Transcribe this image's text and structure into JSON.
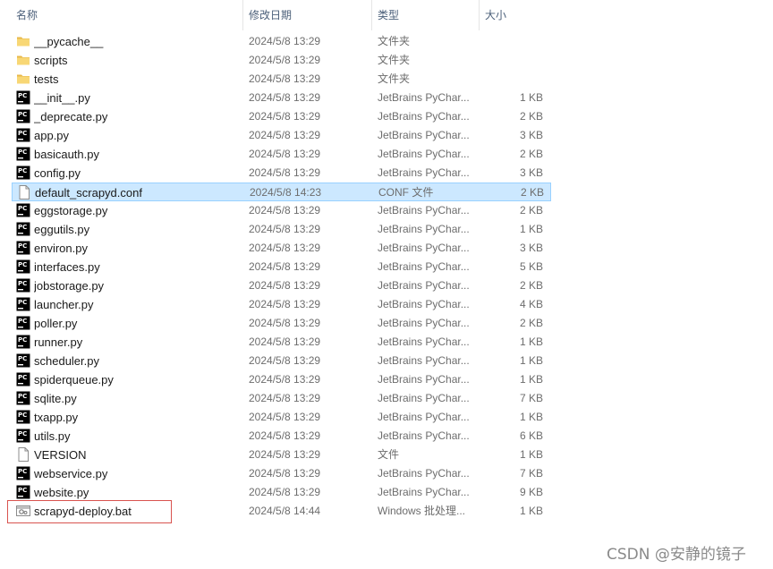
{
  "columns": {
    "name": "名称",
    "modified": "修改日期",
    "type": "类型",
    "size": "大小"
  },
  "files": [
    {
      "name": "__pycache__",
      "modified": "2024/5/8 13:29",
      "type": "文件夹",
      "size": "",
      "icon": "folder-icon"
    },
    {
      "name": "scripts",
      "modified": "2024/5/8 13:29",
      "type": "文件夹",
      "size": "",
      "icon": "folder-icon"
    },
    {
      "name": "tests",
      "modified": "2024/5/8 13:29",
      "type": "文件夹",
      "size": "",
      "icon": "folder-icon"
    },
    {
      "name": "__init__.py",
      "modified": "2024/5/8 13:29",
      "type": "JetBrains PyChar...",
      "size": "1 KB",
      "icon": "pycharm-file-icon"
    },
    {
      "name": "_deprecate.py",
      "modified": "2024/5/8 13:29",
      "type": "JetBrains PyChar...",
      "size": "2 KB",
      "icon": "pycharm-file-icon"
    },
    {
      "name": "app.py",
      "modified": "2024/5/8 13:29",
      "type": "JetBrains PyChar...",
      "size": "3 KB",
      "icon": "pycharm-file-icon"
    },
    {
      "name": "basicauth.py",
      "modified": "2024/5/8 13:29",
      "type": "JetBrains PyChar...",
      "size": "2 KB",
      "icon": "pycharm-file-icon"
    },
    {
      "name": "config.py",
      "modified": "2024/5/8 13:29",
      "type": "JetBrains PyChar...",
      "size": "3 KB",
      "icon": "pycharm-file-icon"
    },
    {
      "name": "default_scrapyd.conf",
      "modified": "2024/5/8 14:23",
      "type": "CONF 文件",
      "size": "2 KB",
      "icon": "blank-file-icon",
      "selected": true
    },
    {
      "name": "eggstorage.py",
      "modified": "2024/5/8 13:29",
      "type": "JetBrains PyChar...",
      "size": "2 KB",
      "icon": "pycharm-file-icon"
    },
    {
      "name": "eggutils.py",
      "modified": "2024/5/8 13:29",
      "type": "JetBrains PyChar...",
      "size": "1 KB",
      "icon": "pycharm-file-icon"
    },
    {
      "name": "environ.py",
      "modified": "2024/5/8 13:29",
      "type": "JetBrains PyChar...",
      "size": "3 KB",
      "icon": "pycharm-file-icon"
    },
    {
      "name": "interfaces.py",
      "modified": "2024/5/8 13:29",
      "type": "JetBrains PyChar...",
      "size": "5 KB",
      "icon": "pycharm-file-icon"
    },
    {
      "name": "jobstorage.py",
      "modified": "2024/5/8 13:29",
      "type": "JetBrains PyChar...",
      "size": "2 KB",
      "icon": "pycharm-file-icon"
    },
    {
      "name": "launcher.py",
      "modified": "2024/5/8 13:29",
      "type": "JetBrains PyChar...",
      "size": "4 KB",
      "icon": "pycharm-file-icon"
    },
    {
      "name": "poller.py",
      "modified": "2024/5/8 13:29",
      "type": "JetBrains PyChar...",
      "size": "2 KB",
      "icon": "pycharm-file-icon"
    },
    {
      "name": "runner.py",
      "modified": "2024/5/8 13:29",
      "type": "JetBrains PyChar...",
      "size": "1 KB",
      "icon": "pycharm-file-icon"
    },
    {
      "name": "scheduler.py",
      "modified": "2024/5/8 13:29",
      "type": "JetBrains PyChar...",
      "size": "1 KB",
      "icon": "pycharm-file-icon"
    },
    {
      "name": "spiderqueue.py",
      "modified": "2024/5/8 13:29",
      "type": "JetBrains PyChar...",
      "size": "1 KB",
      "icon": "pycharm-file-icon"
    },
    {
      "name": "sqlite.py",
      "modified": "2024/5/8 13:29",
      "type": "JetBrains PyChar...",
      "size": "7 KB",
      "icon": "pycharm-file-icon"
    },
    {
      "name": "txapp.py",
      "modified": "2024/5/8 13:29",
      "type": "JetBrains PyChar...",
      "size": "1 KB",
      "icon": "pycharm-file-icon"
    },
    {
      "name": "utils.py",
      "modified": "2024/5/8 13:29",
      "type": "JetBrains PyChar...",
      "size": "6 KB",
      "icon": "pycharm-file-icon"
    },
    {
      "name": "VERSION",
      "modified": "2024/5/8 13:29",
      "type": "文件",
      "size": "1 KB",
      "icon": "blank-file-icon"
    },
    {
      "name": "webservice.py",
      "modified": "2024/5/8 13:29",
      "type": "JetBrains PyChar...",
      "size": "7 KB",
      "icon": "pycharm-file-icon"
    },
    {
      "name": "website.py",
      "modified": "2024/5/8 13:29",
      "type": "JetBrains PyChar...",
      "size": "9 KB",
      "icon": "pycharm-file-icon"
    },
    {
      "name": "scrapyd-deploy.bat",
      "modified": "2024/5/8 14:44",
      "type": "Windows 批处理...",
      "size": "1 KB",
      "icon": "batch-file-icon"
    }
  ],
  "watermark": "CSDN @安静的镜子",
  "colors": {
    "selection_bg": "#cce8ff",
    "selection_border": "#99d1ff",
    "highlight_box": "#d9534f",
    "folder": "#f8d775"
  }
}
